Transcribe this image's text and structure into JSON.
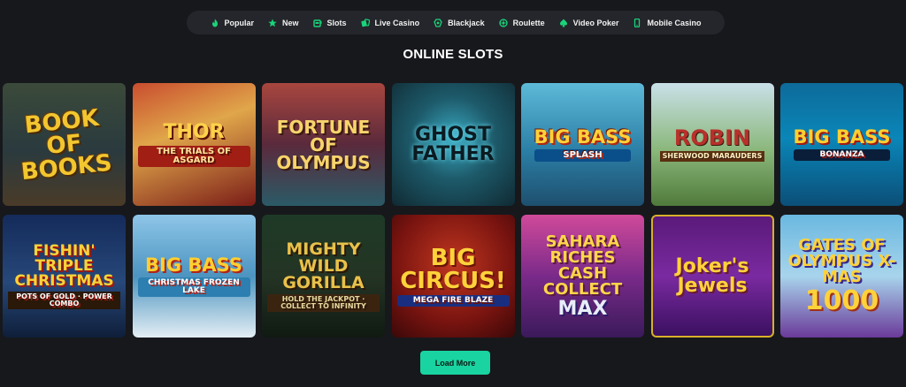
{
  "nav": {
    "items": [
      {
        "label": "Popular",
        "icon": "flame-icon"
      },
      {
        "label": "New",
        "icon": "star-icon"
      },
      {
        "label": "Slots",
        "icon": "slot-machine-icon"
      },
      {
        "label": "Live Casino",
        "icon": "live-cards-icon"
      },
      {
        "label": "Blackjack",
        "icon": "blackjack-icon"
      },
      {
        "label": "Roulette",
        "icon": "roulette-icon"
      },
      {
        "label": "Video Poker",
        "icon": "spade-icon"
      },
      {
        "label": "Mobile Casino",
        "icon": "mobile-icon"
      }
    ],
    "icon_color": "#19d47a"
  },
  "heading": "ONLINE SLOTS",
  "games": [
    {
      "title": "Book of Books",
      "sub": ""
    },
    {
      "title": "Thor",
      "sub": "The Trials of Asgard"
    },
    {
      "title": "Fortune of Olympus",
      "sub": ""
    },
    {
      "title": "Ghost Father",
      "sub": ""
    },
    {
      "title": "Big Bass",
      "sub": "Splash"
    },
    {
      "title": "Robin",
      "sub": "Sherwood Marauders"
    },
    {
      "title": "Big Bass",
      "sub": "Bonanza"
    },
    {
      "title": "Fishin' Triple Christmas",
      "sub": "Pots of Gold · Power Combo"
    },
    {
      "title": "Big Bass",
      "sub": "Christmas Frozen Lake"
    },
    {
      "title": "Mighty Wild Gorilla",
      "sub": "Hold the Jackpot · Collect to Infinity"
    },
    {
      "title": "Big Circus!",
      "sub": "Mega Fire Blaze"
    },
    {
      "title": "Sahara Riches Cash Collect",
      "sub": "MAX"
    },
    {
      "title": "Joker's Jewels",
      "sub": ""
    },
    {
      "title": "Gates of Olympus X-Mas",
      "sub": "1000"
    }
  ],
  "load_more": "Load More",
  "accent_color": "#19d4a0"
}
